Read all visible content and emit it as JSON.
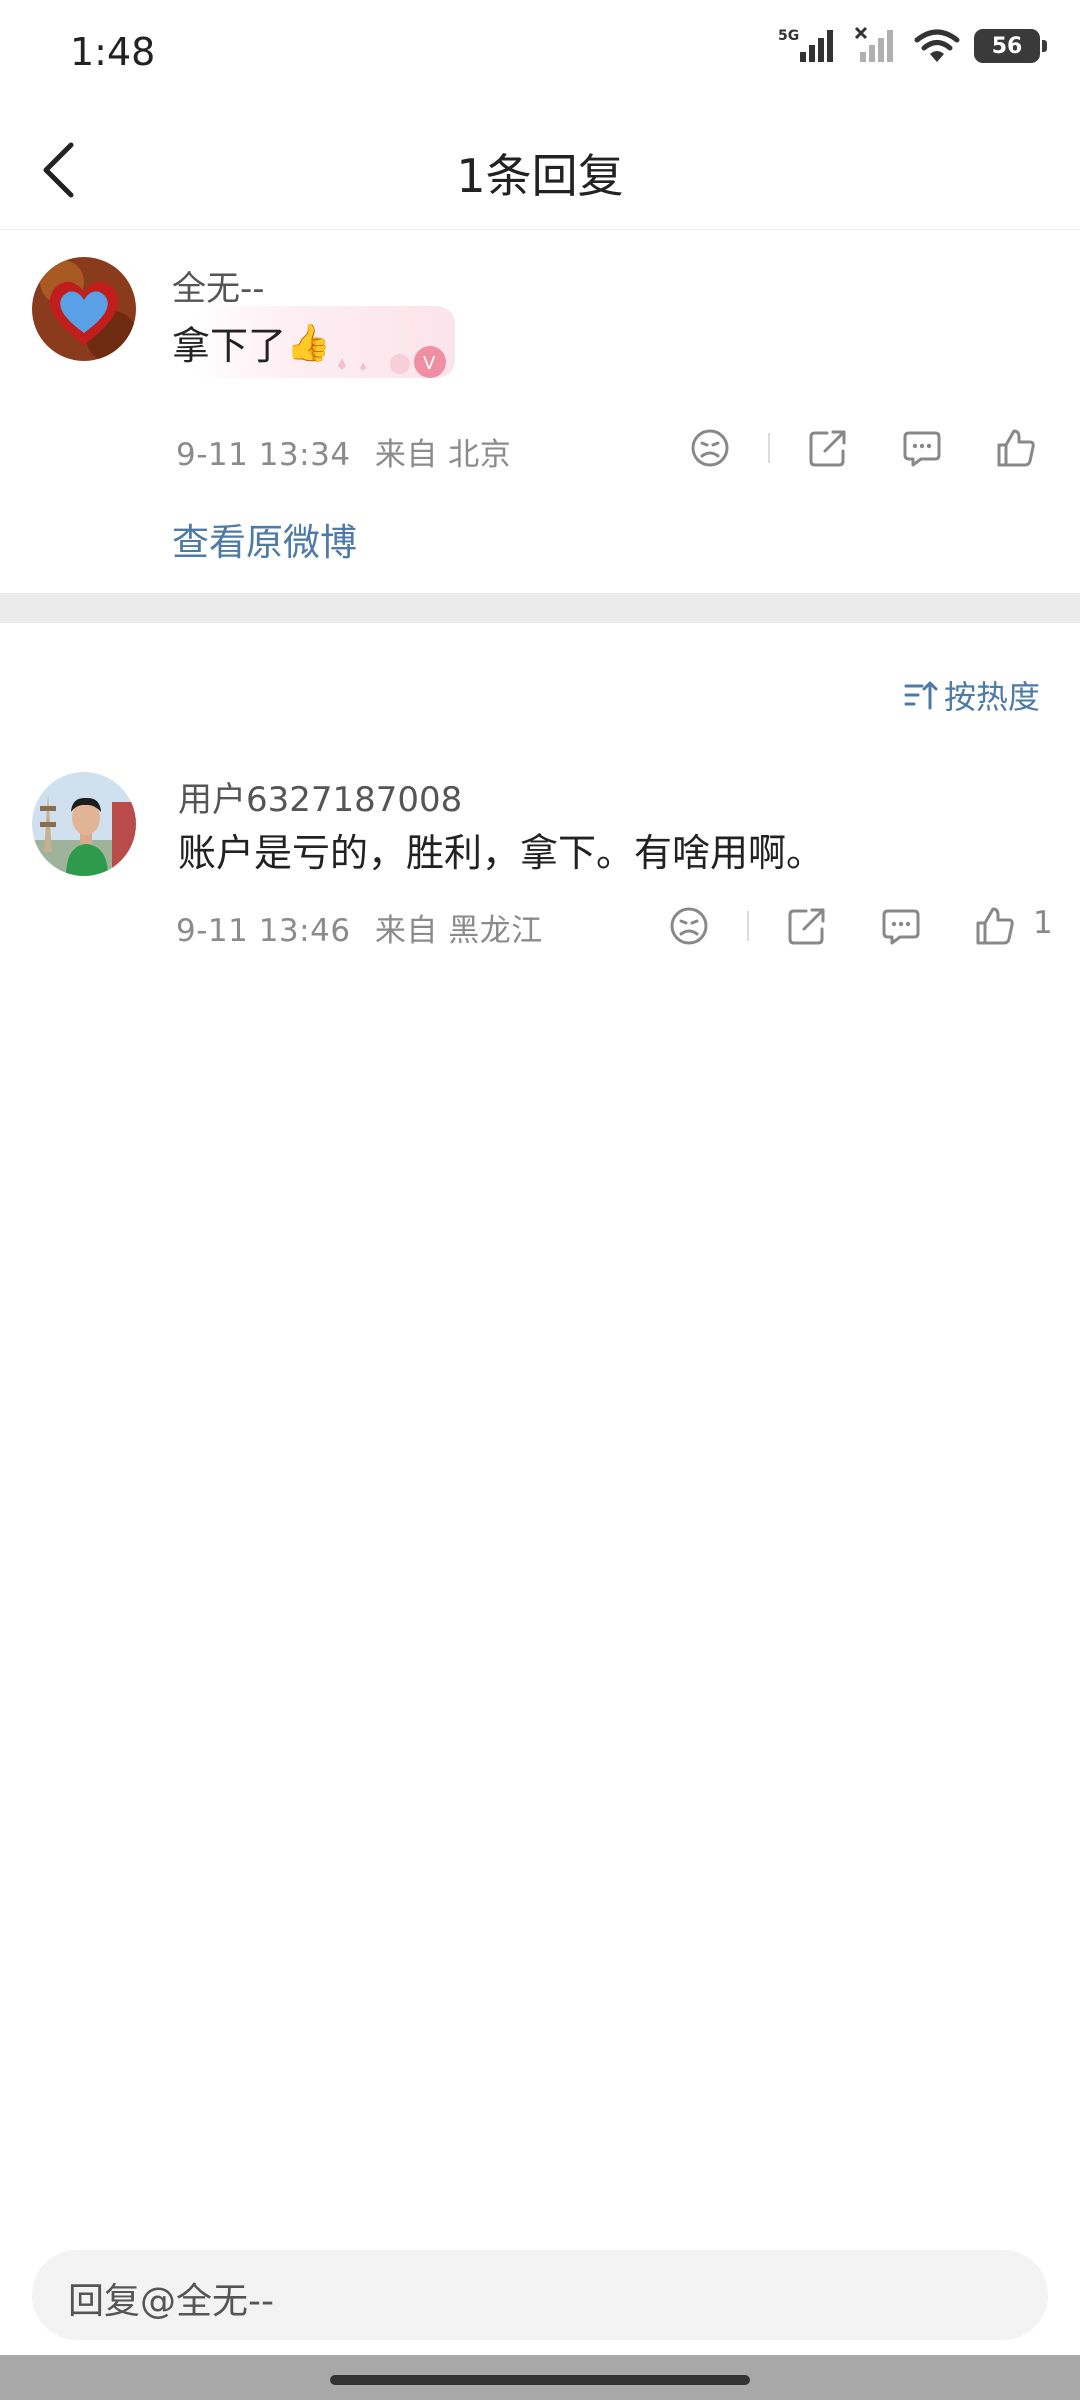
{
  "status": {
    "time": "1:48",
    "network_label": "5G",
    "battery": "56"
  },
  "header": {
    "title": "1条回复"
  },
  "original_comment": {
    "username": "全无--",
    "text": "拿下了",
    "emoji": "👍",
    "time": "9-11 13:34",
    "source": "来自 北京",
    "view_original": "查看原微博"
  },
  "sort": {
    "label": "按热度"
  },
  "replies": [
    {
      "username": "用户6327187008",
      "text": "账户是亏的，胜利，拿下。有啥用啊。",
      "time": "9-11 13:46",
      "source": "来自 黑龙江",
      "like_count": "1"
    }
  ],
  "reply_input": {
    "placeholder": "回复@全无--"
  },
  "colors": {
    "link": "#4e7aa6",
    "meta": "#8b8b8b",
    "divider_band": "#ebebeb"
  }
}
